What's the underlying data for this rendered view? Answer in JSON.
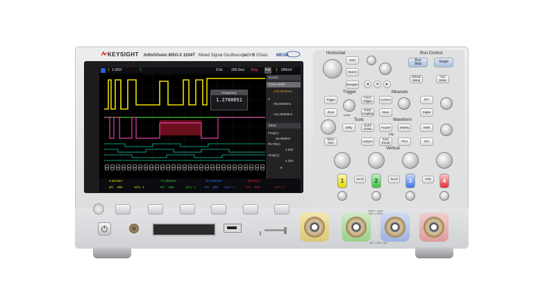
{
  "brand": {
    "name": "KEYSIGHT",
    "model": "InfiniiVision MSO-X 3104T",
    "subtitle": "Mixed Signal Oscilloscope",
    "bandwidth": "1 GHz",
    "sample_rate": "5 GSa/s",
    "mega_logo": "MEGA Zoom"
  },
  "screen": {
    "topbar": {
      "ch1_scale": "1.00V/",
      "ch2_marker": "2",
      "time_pos": "0.0s",
      "time_scale": "200.0ns/",
      "run_state": "Stop",
      "trigger": "1",
      "trig_level": "600mV"
    },
    "side_panel": {
      "events_header": "Events",
      "pulse_width": "Pulse Width",
      "event_1": "-170.00000ns",
      "event_2_idx": "2",
      "event_2": "+55.60000ns",
      "event_3": "+111.80000ns",
      "meas_header": "Meas",
      "freq_label": "Freq(1):",
      "freq_value": "25.000kHz",
      "pkpk_label": "Pk-Pk(1):",
      "pkpk_value": "2.53V",
      "amp_label": "Ampl(1):",
      "amp_value": "2.32V"
    },
    "freq_popup": {
      "title": "Frequency",
      "value": "1.2780651"
    },
    "bus_bytes": [
      "59",
      "59",
      "59",
      "59",
      "59",
      "59",
      "59",
      "59",
      "E4",
      "E4",
      "E4",
      "E4",
      "59",
      "59",
      "59",
      "59",
      "E4",
      "E4",
      "E4",
      "E4",
      "E4",
      "E4",
      "59",
      "59",
      "59",
      "59",
      "59",
      "59",
      "59"
    ],
    "statusbar": {
      "ch1": "3.56750V",
      "ch2": "77.0000mV",
      "ch3": "-20.7500mV",
      "ch4": "-260.0mV",
      "coupling": "DC",
      "bw": "BW",
      "scale": "10.0 : 1"
    }
  },
  "panel": {
    "horizontal": "Horizontal",
    "run_control": "Run Control",
    "run_stop": "Run\nStop",
    "single": "Single",
    "horiz_btn": "Horiz",
    "search": "Search",
    "navigate": "Navigate",
    "default_setup": "Default\nSetup",
    "auto_scale": "Auto\nScale",
    "trigger": "Trigger",
    "measure": "Measure",
    "trigger_btn": "Trigger",
    "force_trigger": "Force\nTrigger",
    "cursors": "Cursors",
    "meas_btn": "Meas",
    "level": "Level",
    "zone": "Zone",
    "mode_coupling": "Mode\nCoupling",
    "tools": "Tools",
    "waveform": "Waveform",
    "file": "File",
    "utility": "Utility",
    "quick_action": "Quick\nAction",
    "acquire": "Acquire",
    "display": "Display",
    "wave_gen": "Wave\nGen",
    "analyze": "Analyze",
    "save_recall": "Save\nRecall",
    "print": "Print",
    "fft": "FFT",
    "digital": "Digital",
    "math": "Math",
    "ref": "Ref",
    "vertical": "Vertical",
    "serial": "Serial",
    "touch": "Touch",
    "help": "Help",
    "ch_labels": [
      "1",
      "2",
      "3",
      "4"
    ]
  },
  "colors": {
    "ch1": "#f2e200",
    "ch2": "#33cc33",
    "ch3": "#3377ff",
    "ch4": "#ee2222",
    "digital": "#17c9a8",
    "bus": "#e43ca8",
    "run_stop": "#c9d9ee"
  },
  "ports": {
    "rating": "1MΩ ≈ 14pF\n300 V RMS",
    "rating2": "5Ω ≤ 300 V pk"
  }
}
